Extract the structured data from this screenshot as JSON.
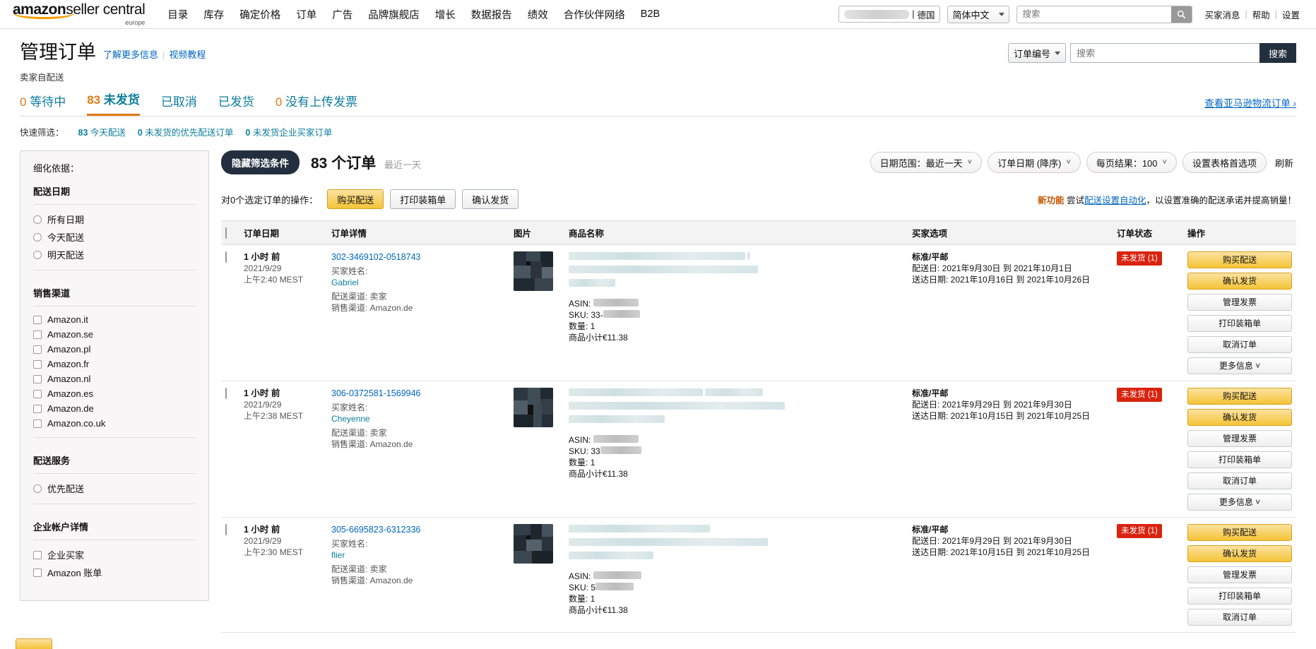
{
  "topnav": {
    "logo_main": "amazon",
    "logo_main2": "seller central",
    "logo_sub": "europe",
    "items": [
      {
        "label": "目录"
      },
      {
        "label": "库存"
      },
      {
        "label": "确定价格"
      },
      {
        "label": "订单"
      },
      {
        "label": "广告"
      },
      {
        "label": "品牌旗舰店"
      },
      {
        "label": "增长"
      },
      {
        "label": "数据报告"
      },
      {
        "label": "绩效"
      },
      {
        "label": "合作伙伴网络"
      },
      {
        "label": "B2B"
      }
    ],
    "store_country": "德国",
    "store_sep": "|",
    "language": "简体中文",
    "search_placeholder": "搜索",
    "util": [
      {
        "label": "买家消息"
      },
      {
        "label": "帮助"
      },
      {
        "label": "设置"
      }
    ]
  },
  "header": {
    "title": "管理订单",
    "link_learn_more": "了解更多信息",
    "link_video": "视频教程",
    "subtitle": "卖家自配送",
    "order_number_select": "订单编号",
    "search_placeholder": "搜索",
    "search_button": "搜索"
  },
  "tabs": [
    {
      "num": "0",
      "label": "等待中",
      "active": false
    },
    {
      "num": "83",
      "label": "未发货",
      "active": true
    },
    {
      "num": "",
      "label": "已取消",
      "active": false
    },
    {
      "num": "",
      "label": "已发货",
      "active": false
    },
    {
      "num": "0",
      "label": "没有上传发票",
      "active": false
    }
  ],
  "tabs_right_link": "查看亚马逊物流订单 ›",
  "quickfilter": {
    "label": "快速筛选：",
    "items": [
      {
        "num": "83",
        "label": "今天配送"
      },
      {
        "num": "0",
        "label": "未发货的优先配送订单"
      },
      {
        "num": "0",
        "label": "未发货企业买家订单"
      }
    ]
  },
  "sidebar": {
    "heading": "细化依据：",
    "sections": [
      {
        "title": "配送日期",
        "type": "radio",
        "options": [
          {
            "label": "所有日期"
          },
          {
            "label": "今天配送"
          },
          {
            "label": "明天配送"
          }
        ]
      },
      {
        "title": "销售渠道",
        "type": "checkbox",
        "options": [
          {
            "label": "Amazon.it"
          },
          {
            "label": "Amazon.se"
          },
          {
            "label": "Amazon.pl"
          },
          {
            "label": "Amazon.fr"
          },
          {
            "label": "Amazon.nl"
          },
          {
            "label": "Amazon.es"
          },
          {
            "label": "Amazon.de"
          },
          {
            "label": "Amazon.co.uk"
          }
        ]
      },
      {
        "title": "配送服务",
        "type": "radio",
        "options": [
          {
            "label": "优先配送"
          }
        ]
      },
      {
        "title": "企业帐户详情",
        "type": "checkbox",
        "options": [
          {
            "label": "企业买家"
          },
          {
            "label": "Amazon 账单"
          }
        ]
      }
    ]
  },
  "toolbar": {
    "hide_filters": "隐藏筛选条件",
    "count_num": "83",
    "count_label": "个订单",
    "count_recent": "最近一天",
    "date_range": "日期范围：最近一天",
    "sort": "订单日期 (降序)",
    "per_page": "每页结果：100",
    "table_prefs": "设置表格首选项",
    "refresh": "刷新"
  },
  "actionbar": {
    "label": "对0个选定订单的操作：",
    "buy_shipping": "购买配送",
    "print_packing_slip": "打印装箱单",
    "confirm_shipment": "确认发货",
    "promo_new": "新功能",
    "promo_text_1": "尝试",
    "promo_link": "配送设置自动化",
    "promo_text_2": "，以设置准确的配送承诺并提高销量！"
  },
  "table": {
    "columns": [
      {
        "key": "checkbox",
        "label": ""
      },
      {
        "key": "date",
        "label": "订单日期"
      },
      {
        "key": "detail",
        "label": "订单详情"
      },
      {
        "key": "image",
        "label": "图片"
      },
      {
        "key": "name",
        "label": "商品名称"
      },
      {
        "key": "buyer",
        "label": "买家选项"
      },
      {
        "key": "status",
        "label": "订单状态"
      },
      {
        "key": "action",
        "label": "操作"
      }
    ],
    "labels": {
      "buyer_name": "买家姓名:",
      "ship_channel": "配送渠道: 卖家",
      "sales_channel": "销售渠道: Amazon.de",
      "asin": "ASIN:",
      "sku": "SKU:",
      "qty": "数量:",
      "subtotal": "商品小计"
    },
    "rows": [
      {
        "ago": "1 小时 前",
        "date": "2021/9/29",
        "time": "上午2:40 MEST",
        "order_id": "302-3469102-0518743",
        "buyer_name": "Gabriel",
        "ship_channel": "配送渠道: 卖家",
        "sales_channel": "销售渠道: Amazon.de",
        "asin_value": "",
        "sku_value": "33-",
        "qty": "1",
        "subtotal": "€11.38",
        "buyer_option": "标准/平邮",
        "ship_by": "配送日: 2021年9月30日 到 2021年10月1日",
        "deliver_by": "送达日期: 2021年10月16日 到 2021年10月26日",
        "status": "未发货 (1)",
        "actions": [
          {
            "label": "购买配送",
            "style": "y"
          },
          {
            "label": "确认发货",
            "style": "y"
          },
          {
            "label": "管理发票",
            "style": "g"
          },
          {
            "label": "打印装箱单",
            "style": "g"
          },
          {
            "label": "取消订单",
            "style": "g"
          },
          {
            "label": "更多信息 ˅",
            "style": "g"
          }
        ]
      },
      {
        "ago": "1 小时 前",
        "date": "2021/9/29",
        "time": "上午2:38 MEST",
        "order_id": "306-0372581-1569946",
        "buyer_name": "Cheyenne",
        "ship_channel": "配送渠道: 卖家",
        "sales_channel": "销售渠道: Amazon.de",
        "asin_value": "",
        "sku_value": "33",
        "qty": "1",
        "subtotal": "€11.38",
        "buyer_option": "标准/平邮",
        "ship_by": "配送日: 2021年9月29日 到 2021年9月30日",
        "deliver_by": "送达日期: 2021年10月15日 到 2021年10月25日",
        "status": "未发货 (1)",
        "actions": [
          {
            "label": "购买配送",
            "style": "y"
          },
          {
            "label": "确认发货",
            "style": "y"
          },
          {
            "label": "管理发票",
            "style": "g"
          },
          {
            "label": "打印装箱单",
            "style": "g"
          },
          {
            "label": "取消订单",
            "style": "g"
          },
          {
            "label": "更多信息 ˅",
            "style": "g"
          }
        ]
      },
      {
        "ago": "1 小时 前",
        "date": "2021/9/29",
        "time": "上午2:30 MEST",
        "order_id": "305-6695823-6312336",
        "buyer_name": "flier",
        "ship_channel": "配送渠道: 卖家",
        "sales_channel": "销售渠道: Amazon.de",
        "asin_value": "",
        "sku_value": "5",
        "qty": "1",
        "subtotal": "€11.38",
        "buyer_option": "标准/平邮",
        "ship_by": "配送日: 2021年9月29日 到 2021年9月30日",
        "deliver_by": "送达日期: 2021年10月15日 到 2021年10月25日",
        "status": "未发货 (1)",
        "actions": [
          {
            "label": "购买配送",
            "style": "y"
          },
          {
            "label": "确认发货",
            "style": "y"
          },
          {
            "label": "管理发票",
            "style": "g"
          },
          {
            "label": "打印装箱单",
            "style": "g"
          },
          {
            "label": "取消订单",
            "style": "g"
          }
        ]
      }
    ]
  }
}
